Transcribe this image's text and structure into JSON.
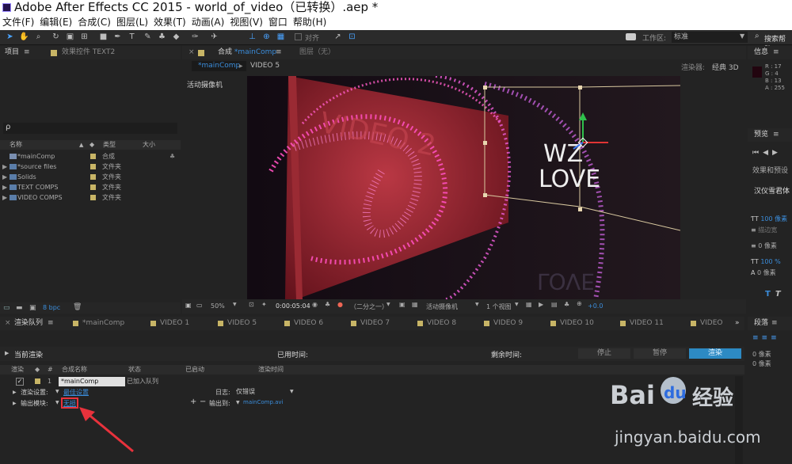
{
  "window": {
    "title": "Adobe After Effects CC 2015 - world_of_video（已转换）.aep *"
  },
  "menu": [
    "文件(F)",
    "编辑(E)",
    "合成(C)",
    "图层(L)",
    "效果(T)",
    "动画(A)",
    "视图(V)",
    "窗口",
    "帮助(H)"
  ],
  "toolbar": {
    "snap_label": "对齐",
    "workspace_label": "工作区:",
    "workspace_value": "标准",
    "search_placeholder": "搜索帮助"
  },
  "project_panel": {
    "tab": "项目",
    "effect_tab": "效果控件 TEXT2",
    "search_glyph": "ρ",
    "columns": {
      "name": "名称",
      "type": "类型",
      "size": "大小"
    },
    "items": [
      {
        "name": "*mainComp",
        "type": "合成"
      },
      {
        "name": "*source files",
        "type": "文件夹"
      },
      {
        "name": "Solids",
        "type": "文件夹"
      },
      {
        "name": "TEXT COMPS",
        "type": "文件夹"
      },
      {
        "name": "VIDEO COMPS",
        "type": "文件夹"
      }
    ],
    "bpc": "8 bpc"
  },
  "composition_panel": {
    "tab": "合成",
    "tab_comp": "*mainComp",
    "layer_tab": "图层（无）",
    "subtab_active": "*mainComp",
    "subtab_other": "VIDEO 5",
    "renderer_label": "渲染器:",
    "renderer_value": "经典 3D",
    "camera_label": "活动摄像机",
    "viewer_text_1": "WZ",
    "viewer_text_2": "LOVE",
    "viewer_bg_text": "VIDEO 2",
    "viewer_reflection": "LOVE",
    "bottom": {
      "zoom": "50%",
      "timecode": "0:00:05:04",
      "resolution": "（二分之一）",
      "view": "活动摄像机",
      "views": "1 个视图",
      "exposure": "+0.0"
    }
  },
  "info_panel": {
    "tab": "信息",
    "R": "R : 17",
    "G": "G : 4",
    "B": "B : 13",
    "A": "A : 255"
  },
  "preview_panel": {
    "tab": "预览"
  },
  "effects_panel": {
    "tab": "效果和预设"
  },
  "character_panel": {
    "font": "汉仪雪君体",
    "size": "100 像素",
    "stroke": "描边宽",
    "px0": "0 像素",
    "scale": "100 %",
    "px0b": "0 像素"
  },
  "paragraph_panel": {
    "tab": "段落",
    "px1": "0 像素",
    "px2": "0 像素"
  },
  "timeline_tabs": [
    "渲染队列",
    "*mainComp",
    "VIDEO 1",
    "VIDEO 5",
    "VIDEO 6",
    "VIDEO 7",
    "VIDEO 8",
    "VIDEO 9",
    "VIDEO 10",
    "VIDEO 11",
    "VIDEO"
  ],
  "render_queue": {
    "current_render": "当前渲染",
    "elapsed": "已用时间:",
    "remaining": "剩余时间:",
    "btn_stop": "停止",
    "btn_pause": "暂停",
    "btn_render": "渲染",
    "headers": {
      "render": "渲染",
      "num": "#",
      "comp": "合成名称",
      "status": "状态",
      "started": "已启动",
      "time": "渲染时间"
    },
    "item": {
      "num": "1",
      "comp": "*mainComp",
      "status": "已加入队列"
    },
    "render_settings_label": "渲染设置:",
    "render_settings_value": "最佳设置",
    "log_label": "日志:",
    "log_value": "仅错误",
    "output_module_label": "输出模块:",
    "output_module_value": "无损",
    "output_to_label": "输出到:",
    "output_to_value": "mainComp.avi"
  },
  "watermark": {
    "text": "Bai",
    "paw": "du",
    "brand": "经验",
    "url": "jingyan.baidu.com"
  },
  "colors": {
    "accent_blue": "#2d8ac4",
    "link": "#3b8ddb",
    "folder": "#c8b566",
    "annotation": "#e8323c"
  }
}
